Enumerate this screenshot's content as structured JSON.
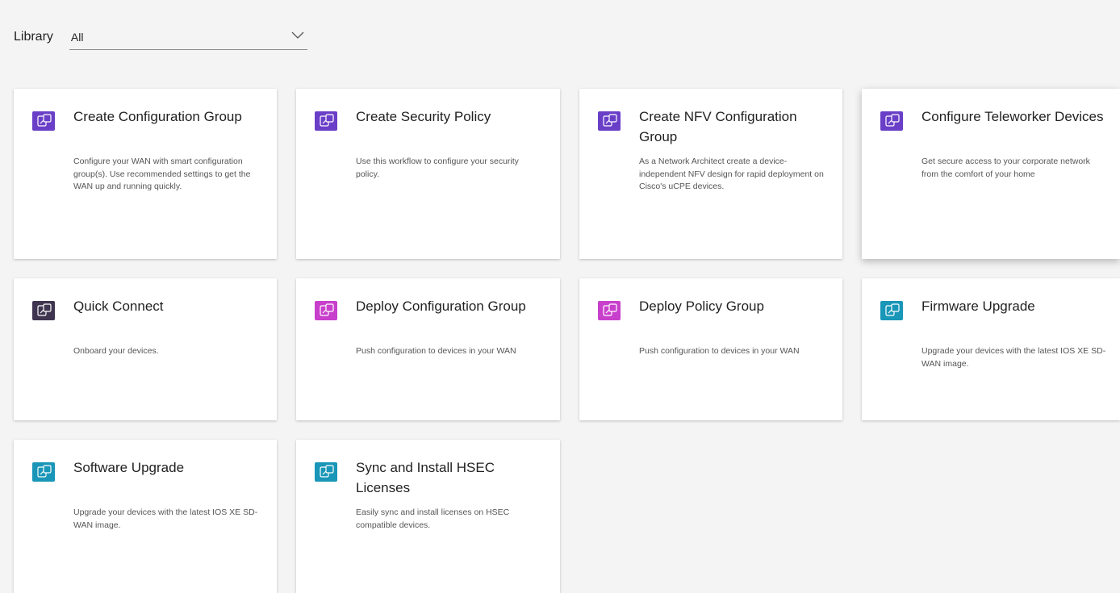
{
  "header": {
    "library_label": "Library",
    "filter_value": "All"
  },
  "colors": {
    "purple": "#6a3fc8",
    "dark": "#3f3550",
    "magenta": "#c83fcc",
    "teal": "#1996b8"
  },
  "cards": [
    {
      "title": "Create Configuration Group",
      "description": "Configure your WAN with smart configuration group(s). Use recommended settings to get the WAN up and running quickly.",
      "icon": "workflow-icon",
      "icon_color": "#6a3fc8"
    },
    {
      "title": "Create Security Policy",
      "description": "Use this workflow to configure your security policy.",
      "icon": "workflow-icon",
      "icon_color": "#6a3fc8"
    },
    {
      "title": "Create NFV Configuration Group",
      "description": "As a Network Architect create a device-independent NFV design for rapid deployment on Cisco's uCPE devices.",
      "icon": "workflow-icon",
      "icon_color": "#6a3fc8"
    },
    {
      "title": "Configure Teleworker Devices",
      "description": "Get secure access to your corporate network from the comfort of your home",
      "icon": "workflow-icon",
      "icon_color": "#6a3fc8"
    },
    {
      "title": "Quick Connect",
      "description": "Onboard your devices.",
      "icon": "workflow-icon",
      "icon_color": "#3f3550"
    },
    {
      "title": "Deploy Configuration Group",
      "description": "Push configuration to devices in your WAN",
      "icon": "workflow-icon",
      "icon_color": "#c83fcc"
    },
    {
      "title": "Deploy Policy Group",
      "description": "Push configuration to devices in your WAN",
      "icon": "workflow-icon",
      "icon_color": "#c83fcc"
    },
    {
      "title": "Firmware Upgrade",
      "description": "Upgrade your devices with the latest IOS XE SD-WAN image.",
      "icon": "workflow-icon",
      "icon_color": "#1996b8"
    },
    {
      "title": "Software Upgrade",
      "description": "Upgrade your devices with the latest IOS XE SD-WAN image.",
      "icon": "workflow-icon",
      "icon_color": "#1996b8"
    },
    {
      "title": "Sync and Install HSEC Licenses",
      "description": "Easily sync and install licenses on HSEC compatible devices.",
      "icon": "workflow-icon",
      "icon_color": "#1996b8"
    }
  ]
}
